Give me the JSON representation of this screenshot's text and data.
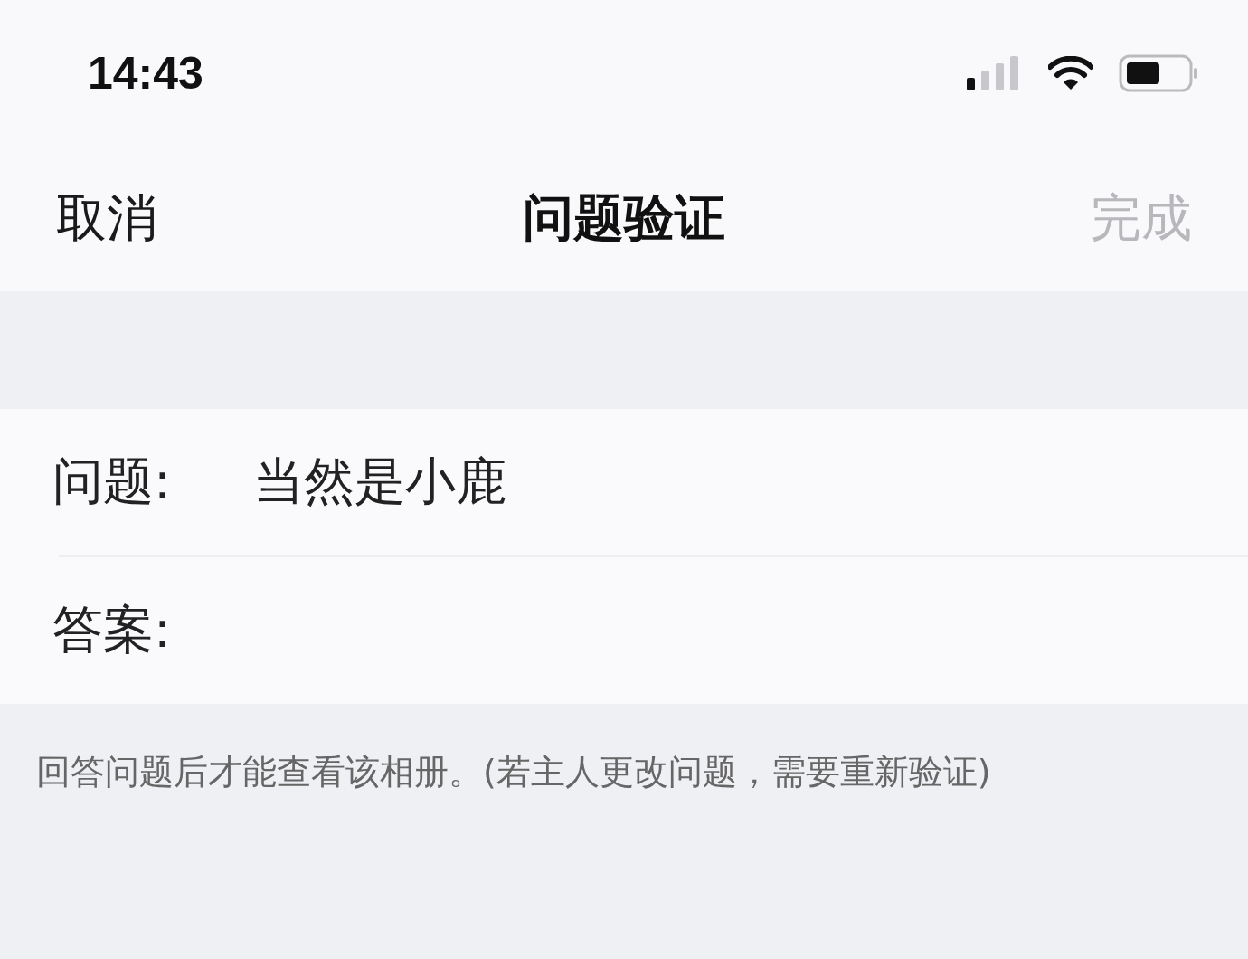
{
  "status_bar": {
    "time": "14:43"
  },
  "nav": {
    "cancel": "取消",
    "title": "问题验证",
    "done": {
      "label": "完成",
      "disabled": true
    }
  },
  "form": {
    "question": {
      "label": "问题:",
      "value": "当然是小鹿"
    },
    "answer": {
      "label": "答案:"
    }
  },
  "footer_note": "回答问题后才能查看该相册。(若主人更改问题，需要重新验证)"
}
